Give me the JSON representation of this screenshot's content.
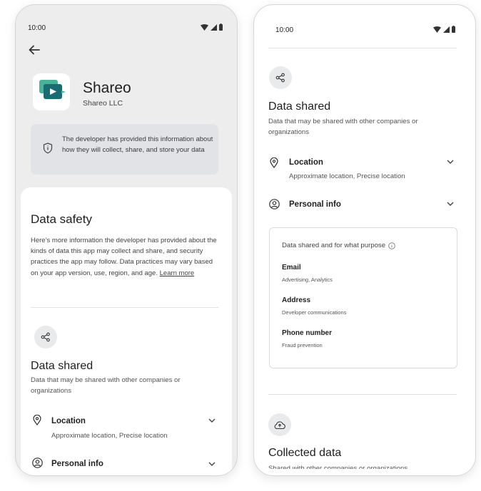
{
  "left": {
    "status_time": "10:00",
    "app": {
      "name": "Shareo",
      "developer": "Shareo LLC",
      "icon": "shareo-app-icon"
    },
    "notice": "The developer has provided this information about how they will collect, share, and store your data",
    "safety": {
      "title": "Data safety",
      "body": "Here’s more information the developer has provided about the kinds of data this app may collect and share, and security practices the app may follow. Data practices may vary based on your app version, use, region, and age.",
      "learn_more": "Learn more"
    },
    "data_shared": {
      "title": "Data shared",
      "subtitle": "Data that may be shared with other companies or organizations",
      "rows": [
        {
          "title": "Location",
          "subtitle": "Approximate location, Precise location",
          "icon": "location-pin-icon"
        },
        {
          "title": "Personal info",
          "icon": "person-icon"
        }
      ]
    }
  },
  "right": {
    "status_time": "10:00",
    "data_shared": {
      "title": "Data shared",
      "subtitle": "Data that may be shared with other companies or organizations",
      "rows": [
        {
          "title": "Location",
          "subtitle": "Approximate location, Precise location",
          "icon": "location-pin-icon"
        },
        {
          "title": "Personal info",
          "icon": "person-icon"
        }
      ]
    },
    "purpose": {
      "heading": "Data shared and for what purpose",
      "items": [
        {
          "title": "Email",
          "subtitle": "Advertising, Analytics"
        },
        {
          "title": "Address",
          "subtitle": "Developer communications"
        },
        {
          "title": "Phone number",
          "subtitle": "Fraud prevention"
        }
      ]
    },
    "collected": {
      "title": "Collected data",
      "subtitle": "Shared with other companies or organizations"
    }
  },
  "colors": {
    "app_icon_primary": "#1b6b73",
    "app_icon_secondary": "#49b39a"
  }
}
